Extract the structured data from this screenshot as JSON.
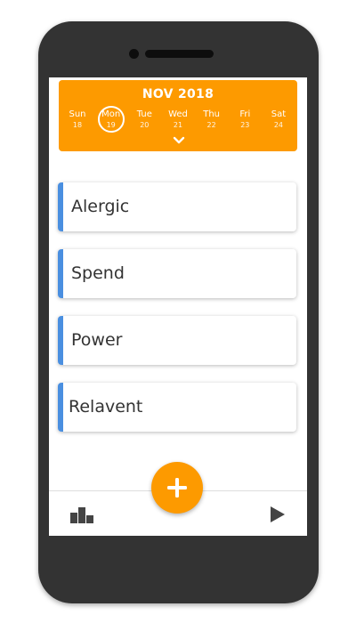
{
  "calendar": {
    "title": "NOV 2018",
    "days": [
      {
        "name": "Sun",
        "num": "18"
      },
      {
        "name": "Mon",
        "num": "19"
      },
      {
        "name": "Tue",
        "num": "20"
      },
      {
        "name": "Wed",
        "num": "21"
      },
      {
        "name": "Thu",
        "num": "22"
      },
      {
        "name": "Fri",
        "num": "23"
      },
      {
        "name": "Sat",
        "num": "24"
      }
    ],
    "selected_day": "Mon",
    "expand_icon": "chevron-down-icon"
  },
  "cards": [
    {
      "label": "Alergic"
    },
    {
      "label": "Spend"
    },
    {
      "label": "Power"
    },
    {
      "label": "Relavent"
    }
  ],
  "bottom_bar": {
    "left_icon": "bar-chart-icon",
    "right_icon": "play-icon"
  },
  "fab": {
    "icon": "plus-icon"
  },
  "colors": {
    "accent": "#fd9a00",
    "card_bar": "#4a8fe0",
    "phone_body": "#333333"
  }
}
